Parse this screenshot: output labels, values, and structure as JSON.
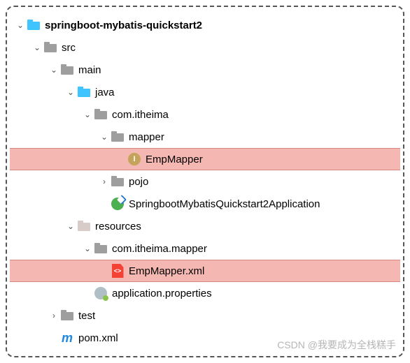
{
  "tree": {
    "root": "springboot-mybatis-quickstart2",
    "src": "src",
    "main": "main",
    "java": "java",
    "pkg_itheima": "com.itheima",
    "mapper_pkg": "mapper",
    "emp_mapper": "EmpMapper",
    "pojo": "pojo",
    "app_class": "SpringbootMybatisQuickstart2Application",
    "resources": "resources",
    "res_pkg": "com.itheima.mapper",
    "emp_mapper_xml": "EmpMapper.xml",
    "app_props": "application.properties",
    "test": "test",
    "pom": "pom.xml"
  },
  "watermark": "CSDN @我要成为全栈糕手"
}
